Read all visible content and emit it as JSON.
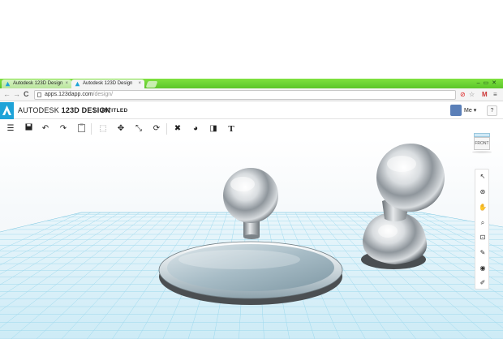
{
  "browser": {
    "tabs": [
      {
        "title": "Autodesk 123D Design",
        "active": false
      },
      {
        "title": "Autodesk 123D Design",
        "active": true
      }
    ],
    "close_glyph": "×",
    "url_host": "apps.123dapp.com",
    "url_path": "/design/",
    "window_controls": "–▭✕",
    "nav": {
      "back": "←",
      "forward": "→",
      "reload": "C"
    },
    "ext_icons": {
      "adblock": "⊘",
      "star": "☆",
      "gmail": "M",
      "menu": "≡"
    }
  },
  "app": {
    "logo_letter": "A",
    "brand_prefix": "AUTODESK",
    "brand_product": "123D DESIGN",
    "separator": "\\",
    "document_title": "UNTITLED",
    "user_label": "Me",
    "user_caret": "▾",
    "help_label": "?"
  },
  "toolbar": {
    "menu_icon": "☰",
    "save_icon": "💾",
    "undo_icon": "↶",
    "redo_icon": "↷",
    "clipboard_icon": "📋",
    "select_icon": "⬚",
    "move_icon": "✥",
    "scale_icon": "⤡",
    "refresh_icon": "⟳",
    "tools_icon": "✖",
    "combine_icon": "◕",
    "group_icon": "◨",
    "text_icon": "T"
  },
  "viewcube": {
    "face_label": "FRONT"
  },
  "nav_tools": [
    "↖",
    "⊛",
    "✋",
    "⌕",
    "⊡",
    "✎",
    "◉",
    "✐"
  ],
  "colors": {
    "brand_blue": "#1fa3d8",
    "chrome_green": "#6bd334",
    "grid_line": "#8fd3ea",
    "grid_bg": "#d9f0f8"
  }
}
